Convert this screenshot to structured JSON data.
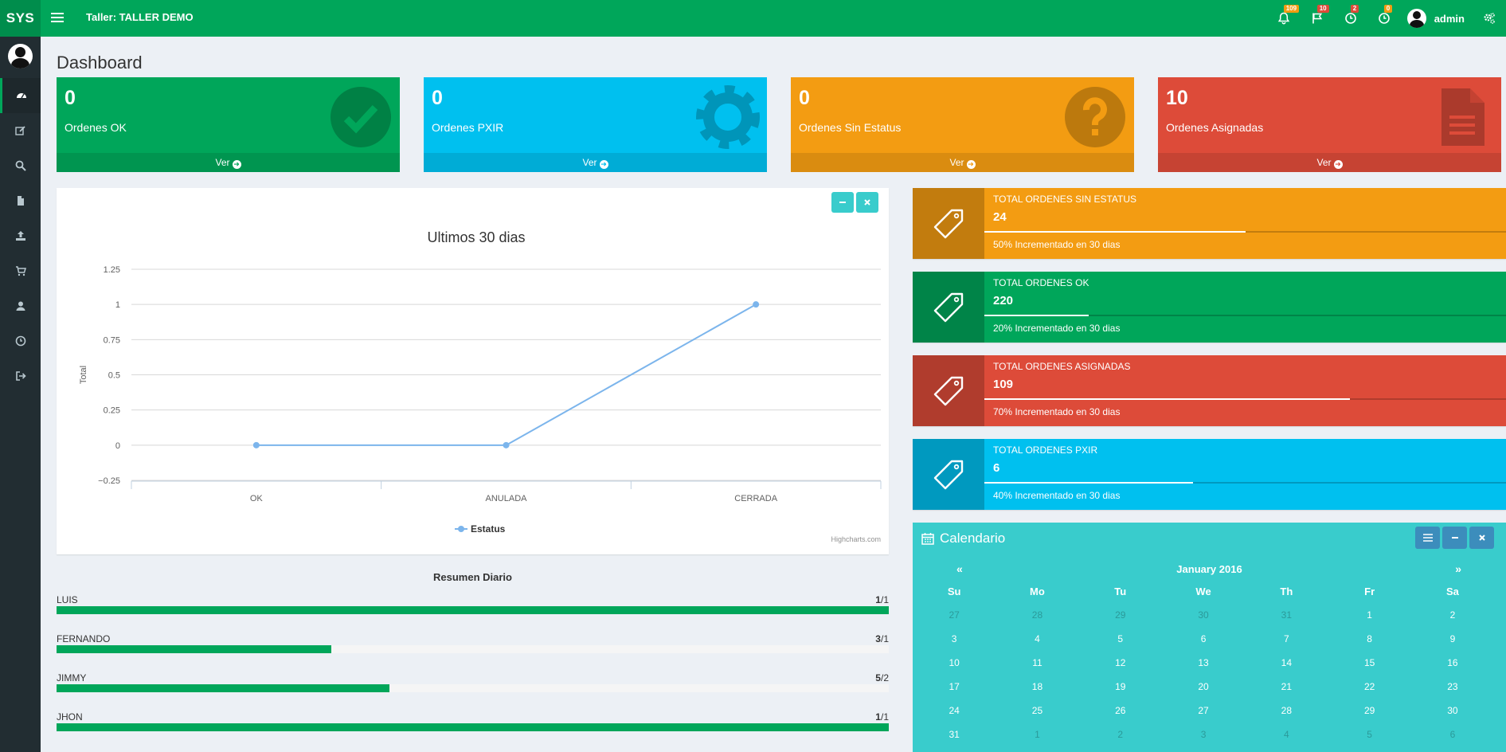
{
  "header": {
    "logo": "SYS",
    "title": "Taller: TALLER DEMO",
    "badges": {
      "notifications": "109",
      "flags": "10",
      "clock1": "2",
      "clock2": "0"
    },
    "user": "admin"
  },
  "page": {
    "title": "Dashboard"
  },
  "small_boxes": [
    {
      "value": "0",
      "label": "Ordenes OK",
      "link": "Ver",
      "color": "#00a65a",
      "icon": "check-circle-icon"
    },
    {
      "value": "0",
      "label": "Ordenes PXIR",
      "link": "Ver",
      "color": "#00c0ef",
      "icon": "gear-icon"
    },
    {
      "value": "0",
      "label": "Ordenes Sin Estatus",
      "link": "Ver",
      "color": "#f39c12",
      "icon": "question-circle-icon"
    },
    {
      "value": "10",
      "label": "Ordenes Asignadas",
      "link": "Ver",
      "color": "#dd4b39",
      "icon": "file-text-icon"
    }
  ],
  "chart_data": {
    "type": "line",
    "title": "Ultimos 30 dias",
    "ylabel": "Total",
    "xlabel": "",
    "categories": [
      "OK",
      "ANULADA",
      "CERRADA"
    ],
    "series": [
      {
        "name": "Estatus",
        "values": [
          0,
          0,
          1
        ]
      }
    ],
    "ylim": [
      -0.25,
      1.25
    ],
    "yticks": [
      "1.25",
      "1",
      "0.75",
      "0.5",
      "0.25",
      "0",
      "−0.25"
    ],
    "grid": true,
    "legend": "bottom-center",
    "credits": "Highcharts.com",
    "color": "#7cb5ec"
  },
  "summary": {
    "title": "Resumen Diario",
    "rows": [
      {
        "name": "LUIS",
        "count_strong": "1",
        "count_rest": "/1",
        "progress": 100
      },
      {
        "name": "FERNANDO",
        "count_strong": "3",
        "count_rest": "/1",
        "progress": 33
      },
      {
        "name": "JIMMY",
        "count_strong": "5",
        "count_rest": "/2",
        "progress": 40
      },
      {
        "name": "JHON",
        "count_strong": "1",
        "count_rest": "/1",
        "progress": 100
      }
    ]
  },
  "info_boxes": [
    {
      "title": "Total Ordenes Sin Estatus",
      "number": "24",
      "progress": 50,
      "desc": "50% Incrementado en 30 dias",
      "color": "#f39c12"
    },
    {
      "title": "Total Ordenes OK",
      "number": "220",
      "progress": 20,
      "desc": "20% Incrementado en 30 dias",
      "color": "#00a65a"
    },
    {
      "title": "Total Ordenes Asignadas",
      "number": "109",
      "progress": 70,
      "desc": "70% Incrementado en 30 dias",
      "color": "#dd4b39"
    },
    {
      "title": "Total Ordenes PXIR",
      "number": "6",
      "progress": 40,
      "desc": "40% Incrementado en 30 dias",
      "color": "#00c0ef"
    }
  ],
  "calendar": {
    "title": "Calendario",
    "month": "January 2016",
    "prev": "«",
    "next": "»",
    "days_of_week": [
      "Su",
      "Mo",
      "Tu",
      "We",
      "Th",
      "Fr",
      "Sa"
    ],
    "weeks": [
      [
        {
          "d": "27",
          "o": true
        },
        {
          "d": "28",
          "o": true
        },
        {
          "d": "29",
          "o": true
        },
        {
          "d": "30",
          "o": true
        },
        {
          "d": "31",
          "o": true
        },
        {
          "d": "1"
        },
        {
          "d": "2"
        }
      ],
      [
        {
          "d": "3"
        },
        {
          "d": "4"
        },
        {
          "d": "5"
        },
        {
          "d": "6"
        },
        {
          "d": "7"
        },
        {
          "d": "8"
        },
        {
          "d": "9"
        }
      ],
      [
        {
          "d": "10"
        },
        {
          "d": "11"
        },
        {
          "d": "12"
        },
        {
          "d": "13"
        },
        {
          "d": "14"
        },
        {
          "d": "15"
        },
        {
          "d": "16"
        }
      ],
      [
        {
          "d": "17"
        },
        {
          "d": "18"
        },
        {
          "d": "19"
        },
        {
          "d": "20"
        },
        {
          "d": "21"
        },
        {
          "d": "22"
        },
        {
          "d": "23"
        }
      ],
      [
        {
          "d": "24"
        },
        {
          "d": "25"
        },
        {
          "d": "26"
        },
        {
          "d": "27"
        },
        {
          "d": "28"
        },
        {
          "d": "29"
        },
        {
          "d": "30"
        }
      ],
      [
        {
          "d": "31"
        },
        {
          "d": "1",
          "o": true
        },
        {
          "d": "2",
          "o": true
        },
        {
          "d": "3",
          "o": true
        },
        {
          "d": "4",
          "o": true
        },
        {
          "d": "5",
          "o": true
        },
        {
          "d": "6",
          "o": true
        }
      ]
    ]
  },
  "sidebar": {
    "items": [
      "dashboard-icon",
      "edit-icon",
      "search-icon",
      "file-icon",
      "upload-icon",
      "cart-icon",
      "user-icon",
      "clock-icon",
      "sign-out-icon"
    ]
  }
}
